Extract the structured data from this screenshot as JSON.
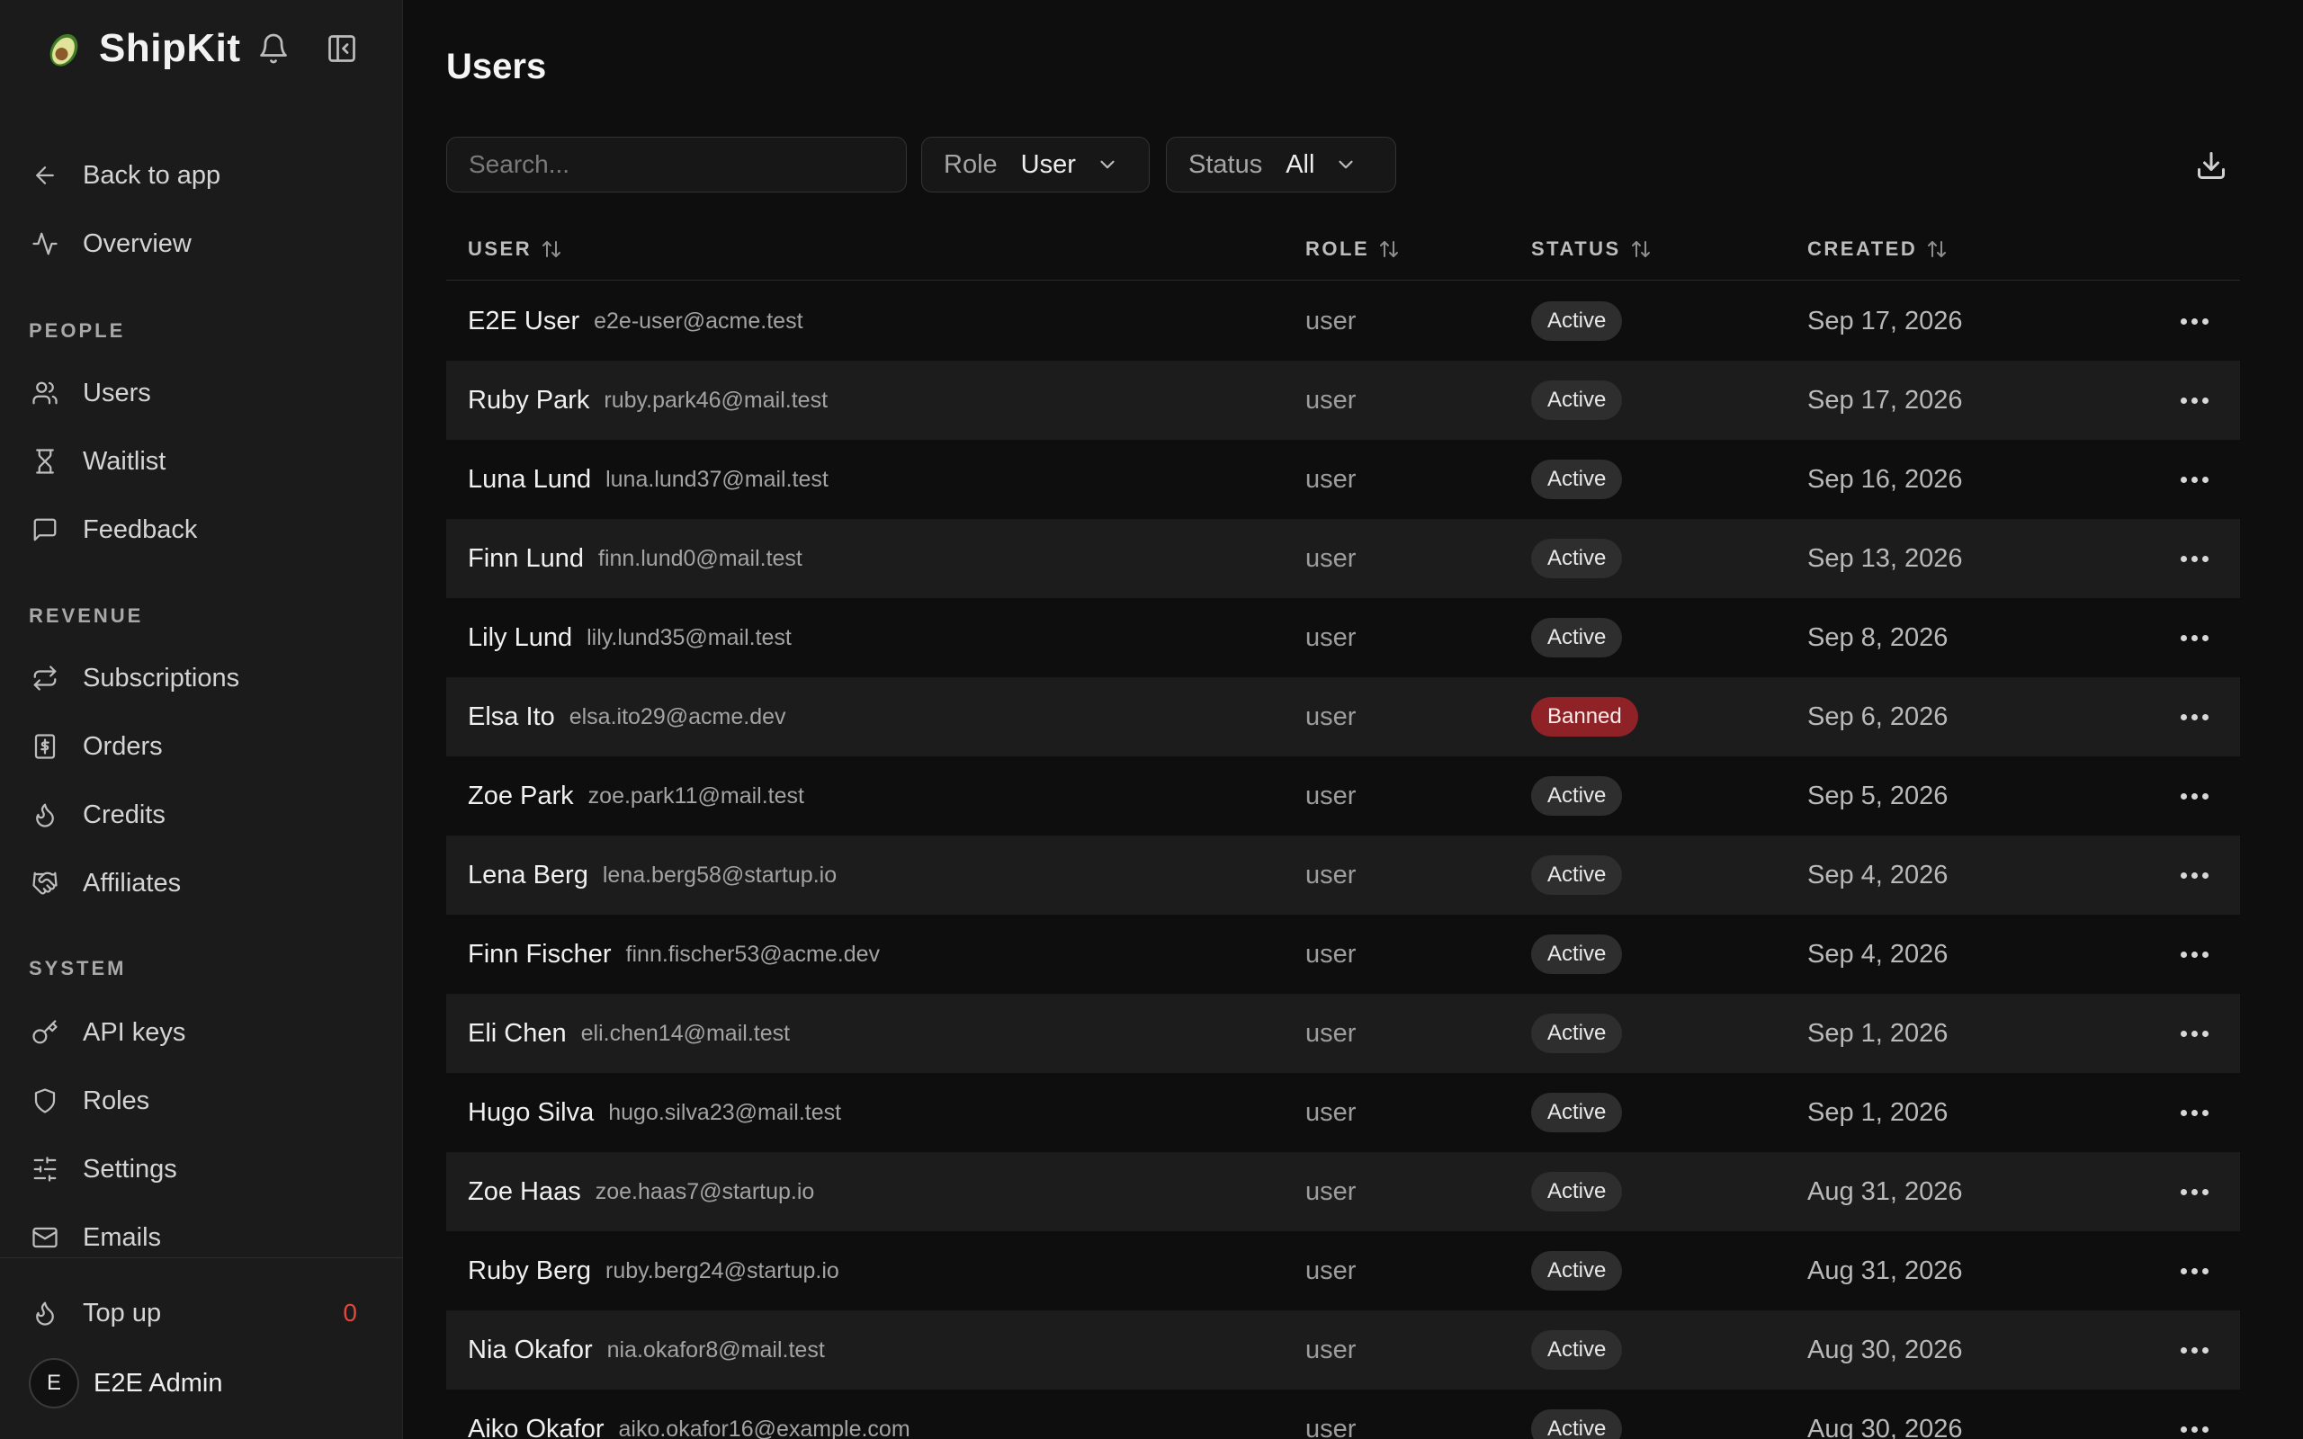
{
  "app": {
    "name": "ShipKit"
  },
  "sidebar": {
    "back": "Back to app",
    "overview": "Overview",
    "sections": {
      "people": "PEOPLE",
      "revenue": "REVENUE",
      "system": "SYSTEM"
    },
    "people_items": [
      "Users",
      "Waitlist",
      "Feedback"
    ],
    "revenue_items": [
      "Subscriptions",
      "Orders",
      "Credits",
      "Affiliates"
    ],
    "system_items": [
      "API keys",
      "Roles",
      "Settings",
      "Emails"
    ],
    "topup": {
      "label": "Top up",
      "count": "0"
    },
    "account": {
      "initial": "E",
      "name": "E2E Admin"
    }
  },
  "page": {
    "title": "Users"
  },
  "toolbar": {
    "search_placeholder": "Search...",
    "role": {
      "label": "Role",
      "value": "User"
    },
    "status": {
      "label": "Status",
      "value": "All"
    }
  },
  "table": {
    "headers": {
      "user": "USER",
      "role": "ROLE",
      "status": "STATUS",
      "created": "CREATED"
    },
    "rows": [
      {
        "name": "E2E User",
        "email": "e2e-user@acme.test",
        "role": "user",
        "status": "Active",
        "created": "Sep 17, 2026"
      },
      {
        "name": "Ruby Park",
        "email": "ruby.park46@mail.test",
        "role": "user",
        "status": "Active",
        "created": "Sep 17, 2026"
      },
      {
        "name": "Luna Lund",
        "email": "luna.lund37@mail.test",
        "role": "user",
        "status": "Active",
        "created": "Sep 16, 2026"
      },
      {
        "name": "Finn Lund",
        "email": "finn.lund0@mail.test",
        "role": "user",
        "status": "Active",
        "created": "Sep 13, 2026"
      },
      {
        "name": "Lily Lund",
        "email": "lily.lund35@mail.test",
        "role": "user",
        "status": "Active",
        "created": "Sep 8, 2026"
      },
      {
        "name": "Elsa Ito",
        "email": "elsa.ito29@acme.dev",
        "role": "user",
        "status": "Banned",
        "created": "Sep 6, 2026"
      },
      {
        "name": "Zoe Park",
        "email": "zoe.park11@mail.test",
        "role": "user",
        "status": "Active",
        "created": "Sep 5, 2026"
      },
      {
        "name": "Lena Berg",
        "email": "lena.berg58@startup.io",
        "role": "user",
        "status": "Active",
        "created": "Sep 4, 2026"
      },
      {
        "name": "Finn Fischer",
        "email": "finn.fischer53@acme.dev",
        "role": "user",
        "status": "Active",
        "created": "Sep 4, 2026"
      },
      {
        "name": "Eli Chen",
        "email": "eli.chen14@mail.test",
        "role": "user",
        "status": "Active",
        "created": "Sep 1, 2026"
      },
      {
        "name": "Hugo Silva",
        "email": "hugo.silva23@mail.test",
        "role": "user",
        "status": "Active",
        "created": "Sep 1, 2026"
      },
      {
        "name": "Zoe Haas",
        "email": "zoe.haas7@startup.io",
        "role": "user",
        "status": "Active",
        "created": "Aug 31, 2026"
      },
      {
        "name": "Ruby Berg",
        "email": "ruby.berg24@startup.io",
        "role": "user",
        "status": "Active",
        "created": "Aug 31, 2026"
      },
      {
        "name": "Nia Okafor",
        "email": "nia.okafor8@mail.test",
        "role": "user",
        "status": "Active",
        "created": "Aug 30, 2026"
      },
      {
        "name": "Aiko Okafor",
        "email": "aiko.okafor16@example.com",
        "role": "user",
        "status": "Active",
        "created": "Aug 30, 2026"
      }
    ]
  },
  "colors": {
    "background": "#0e0e0e",
    "sidebar": "#1b1b1b",
    "banned": "#8f2226",
    "topup_count": "#e0483e"
  },
  "icons": [
    "avocado-logo",
    "bell-icon",
    "sidebar-toggle-icon",
    "arrow-left-icon",
    "activity-icon",
    "users-icon",
    "hourglass-icon",
    "message-square-icon",
    "repeat-icon",
    "receipt-icon",
    "flame-icon",
    "handshake-icon",
    "key-icon",
    "shield-icon",
    "sliders-icon",
    "mail-icon",
    "chevron-down-icon",
    "download-icon",
    "sort-icon",
    "more-icon"
  ]
}
